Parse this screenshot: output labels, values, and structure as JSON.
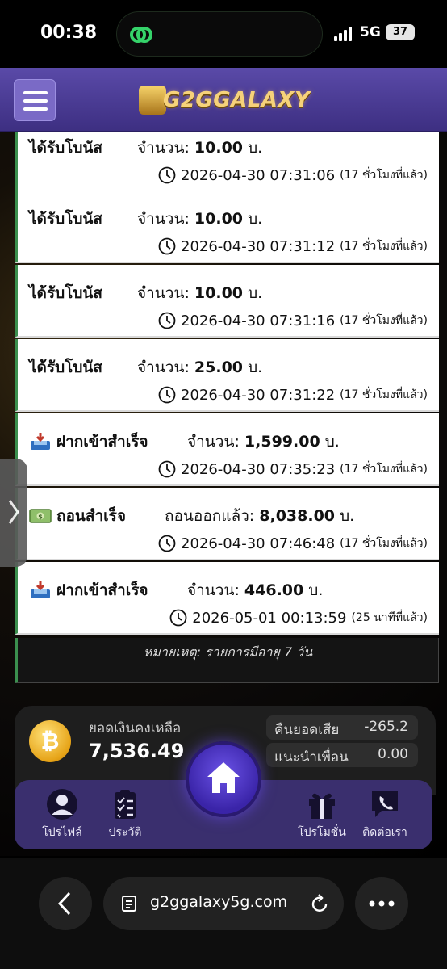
{
  "status_bar": {
    "time": "00:38",
    "network": "5G",
    "battery": "37"
  },
  "header": {
    "logo_text": "G2GGALAXY",
    "menu_icon": "hamburger-icon"
  },
  "transactions": [
    {
      "title": "ได้รับโบนัส",
      "amount_label": "จำนวน:",
      "amount": "10.00",
      "unit": "บ.",
      "datetime": "2026-04-30 07:31:06",
      "relative": "(17 ชั่วโมงที่แล้ว)",
      "icon": ""
    },
    {
      "title": "ได้รับโบนัส",
      "amount_label": "จำนวน:",
      "amount": "10.00",
      "unit": "บ.",
      "datetime": "2026-04-30 07:31:12",
      "relative": "(17 ชั่วโมงที่แล้ว)",
      "icon": ""
    },
    {
      "title": "ได้รับโบนัส",
      "amount_label": "จำนวน:",
      "amount": "10.00",
      "unit": "บ.",
      "datetime": "2026-04-30 07:31:16",
      "relative": "(17 ชั่วโมงที่แล้ว)",
      "icon": ""
    },
    {
      "title": "ได้รับโบนัส",
      "amount_label": "จำนวน:",
      "amount": "25.00",
      "unit": "บ.",
      "datetime": "2026-04-30 07:31:22",
      "relative": "(17 ชั่วโมงที่แล้ว)",
      "icon": ""
    },
    {
      "title": "ฝากเข้าสำเร็จ",
      "amount_label": "จำนวน:",
      "amount": "1,599.00",
      "unit": "บ.",
      "datetime": "2026-04-30 07:35:23",
      "relative": "(17 ชั่วโมงที่แล้ว)",
      "icon": "inbox-tray-icon"
    },
    {
      "title": "ถอนสำเร็จ",
      "amount_label": "ถอนออกแล้ว:",
      "amount": "8,038.00",
      "unit": "บ.",
      "datetime": "2026-04-30 07:46:48",
      "relative": "(17 ชั่วโมงที่แล้ว)",
      "icon": "money-bill-icon"
    },
    {
      "title": "ฝากเข้าสำเร็จ",
      "amount_label": "จำนวน:",
      "amount": "446.00",
      "unit": "บ.",
      "datetime": "2026-05-01 00:13:59",
      "relative": "(25 นาทีที่แล้ว)",
      "icon": "inbox-tray-icon"
    }
  ],
  "note": "หมายเหตุ: รายการมีอายุ 7 วัน",
  "wallet": {
    "balance_label": "ยอดเงินคงเหลือ",
    "balance": "7,536.49",
    "cashback_label": "คืนยอดเสีย",
    "cashback": "-265.2",
    "referral_label": "แนะนำเพื่อน",
    "referral": "0.00"
  },
  "nav": {
    "profile": "โปรไฟล์",
    "history": "ประวัติ",
    "promotions": "โปรโมชั่น",
    "contact": "ติดต่อเรา"
  },
  "browser": {
    "url": "g2ggalaxy5g.com"
  },
  "colors": {
    "header": "#4b3c95",
    "accent_green": "#3b8f4e",
    "nav_bg": "#3a2f6e",
    "gold": "#f6d27a"
  }
}
